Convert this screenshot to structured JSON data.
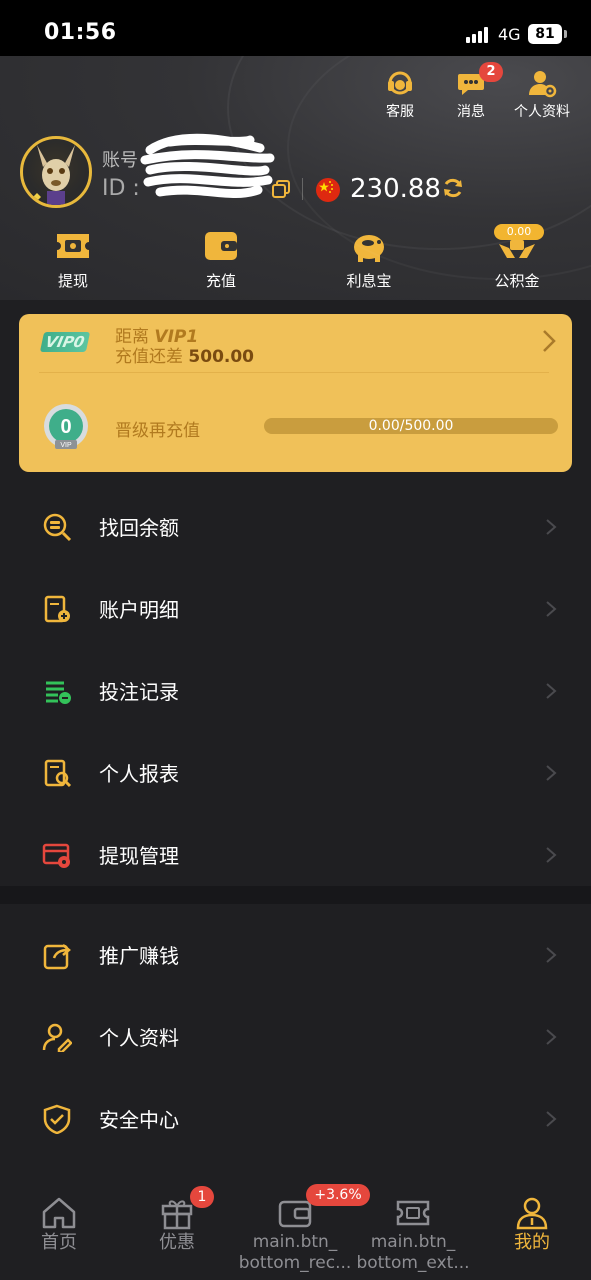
{
  "status_bar": {
    "time": "01:56",
    "network": "4G",
    "battery": "81"
  },
  "top_actions": {
    "support": "客服",
    "messages": "消息",
    "messages_badge": "2",
    "profile": "个人资料"
  },
  "account": {
    "label": "账号",
    "id_prefix": "ID :",
    "balance": "230.88"
  },
  "quick_actions": {
    "withdraw": "提现",
    "deposit": "充值",
    "interest": "利息宝",
    "fund": "公积金",
    "fund_amount": "0.00"
  },
  "vip": {
    "current_level": "VIP0",
    "distance_prefix": "距离",
    "next_level": "VIP1",
    "need_label": "充值还差",
    "need_amount": "500.00",
    "medal_number": "0",
    "medal_caption": "VIP",
    "upgrade_label": "晋级再充值",
    "progress_text": "0.00/500.00",
    "progress": 0.0
  },
  "menu_group_1": [
    {
      "label": "找回余额",
      "icon": "coin-search-icon"
    },
    {
      "label": "账户明细",
      "icon": "document-add-icon"
    },
    {
      "label": "投注记录",
      "icon": "bet-list-icon"
    },
    {
      "label": "个人报表",
      "icon": "report-search-icon"
    },
    {
      "label": "提现管理",
      "icon": "card-gear-icon"
    }
  ],
  "menu_group_2": [
    {
      "label": "推广赚钱",
      "icon": "share-icon"
    },
    {
      "label": "个人资料",
      "icon": "user-edit-icon"
    },
    {
      "label": "安全中心",
      "icon": "shield-check-icon"
    }
  ],
  "bottom_nav": {
    "home": "首页",
    "promo": "优惠",
    "promo_badge": "1",
    "recharge": "main.btn_\nbottom_rec...",
    "recharge_badge": "+3.6%",
    "withdraw": "main.btn_\nbottom_ext...",
    "mine": "我的"
  },
  "colors": {
    "accent": "#f0b63c",
    "card": "#f0c159",
    "badge": "#e5473d",
    "background": "#1f1f22"
  }
}
